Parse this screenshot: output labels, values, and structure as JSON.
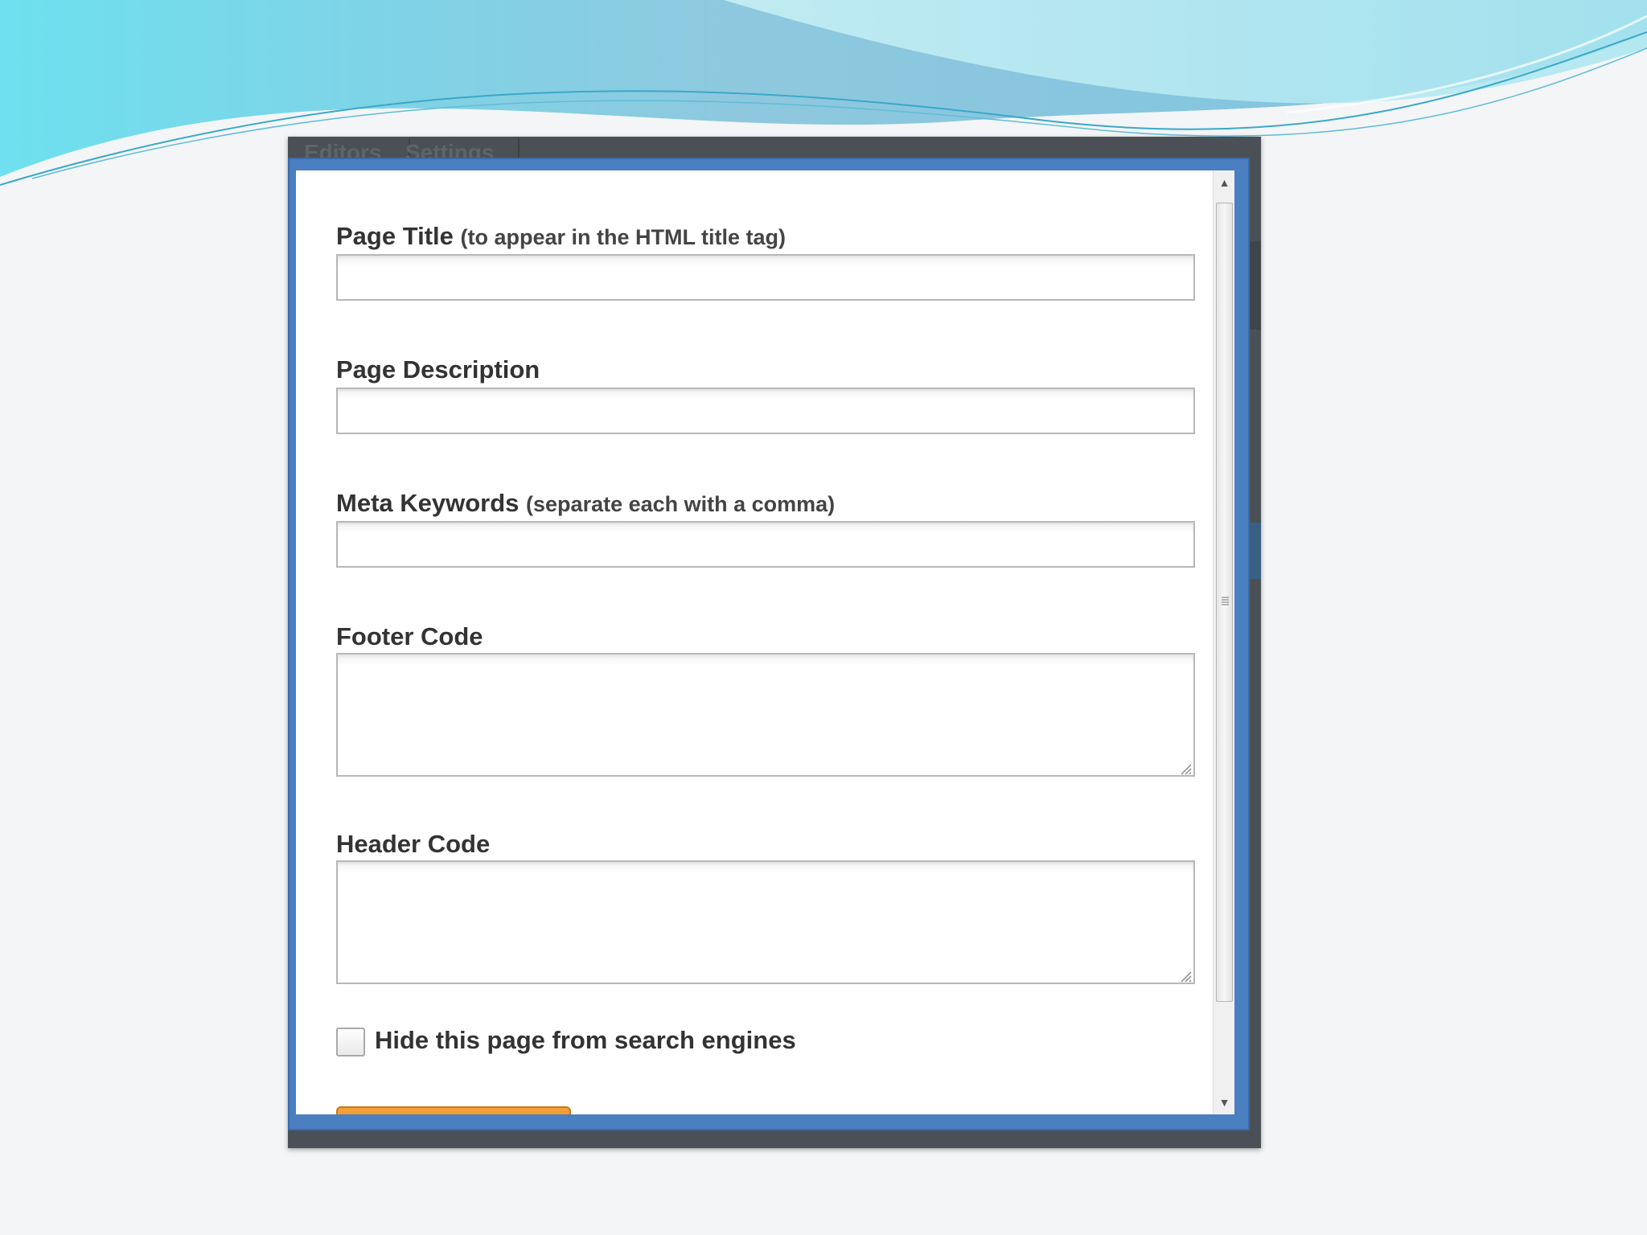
{
  "background": {
    "tabs": [
      "Editors",
      "Settings"
    ]
  },
  "form": {
    "page_title": {
      "label": "Page Title",
      "hint": "(to appear in the HTML title tag)",
      "value": ""
    },
    "page_description": {
      "label": "Page Description",
      "value": ""
    },
    "meta_keywords": {
      "label": "Meta Keywords",
      "hint": "(separate each with a comma)",
      "value": ""
    },
    "footer_code": {
      "label": "Footer Code",
      "value": ""
    },
    "header_code": {
      "label": "Header Code",
      "value": ""
    },
    "hide_from_search": {
      "label": "Hide this page from search engines",
      "checked": false
    }
  },
  "colors": {
    "modal_frame": "#4a7fc1",
    "backdrop": "#4a5056",
    "save_button": "#f09a2e",
    "wave_light": "#8fd8e8",
    "wave_dark": "#3aa8c8"
  },
  "icons": {
    "scroll_up": "triangle-up-icon",
    "scroll_down": "triangle-down-icon",
    "scroll_grip": "grip-lines-icon",
    "resize_grip": "resize-grip-icon"
  }
}
